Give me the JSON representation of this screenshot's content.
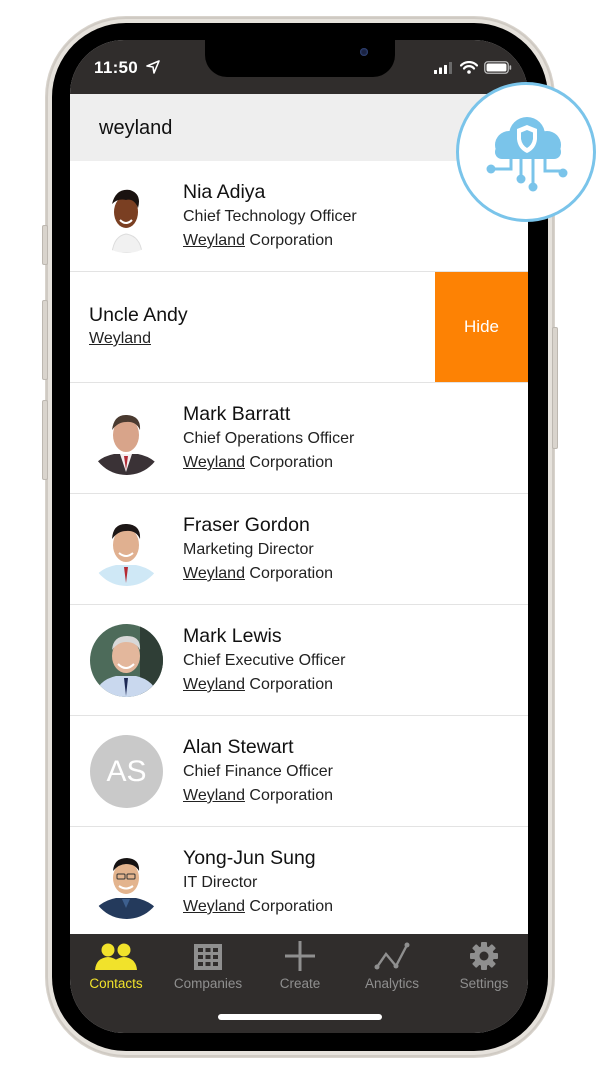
{
  "status_bar": {
    "time": "11:50",
    "icons": [
      "location-arrow-icon",
      "cellular-signal-icon",
      "wifi-icon",
      "battery-icon"
    ]
  },
  "search": {
    "value": "weyland"
  },
  "badge": {
    "icon": "cloud-shield-network-icon",
    "color": "#7ac4ea"
  },
  "contacts": [
    {
      "name": "Nia Adiya",
      "title": "Chief Technology Officer",
      "company_match": "Weyland",
      "company_rest": " Corporation",
      "avatar": "photo"
    },
    {
      "name": "Uncle Andy",
      "company_match": "Weyland",
      "swiped": true,
      "action_label": "Hide",
      "action_color": "#fd8204"
    },
    {
      "name": "Mark Barratt",
      "title": "Chief Operations Officer",
      "company_match": "Weyland",
      "company_rest": " Corporation",
      "avatar": "photo"
    },
    {
      "name": "Fraser Gordon",
      "title": "Marketing Director",
      "company_match": "Weyland",
      "company_rest": " Corporation",
      "avatar": "photo"
    },
    {
      "name": "Mark Lewis",
      "title": "Chief Executive Officer",
      "company_match": "Weyland",
      "company_rest": " Corporation",
      "avatar": "photo"
    },
    {
      "name": "Alan Stewart",
      "title": "Chief Finance Officer",
      "company_match": "Weyland",
      "company_rest": " Corporation",
      "avatar": "initials",
      "initials": "AS"
    },
    {
      "name": "Yong-Jun Sung",
      "title": "IT Director",
      "company_match": "Weyland",
      "company_rest": " Corporation",
      "avatar": "photo"
    }
  ],
  "tabbar": {
    "active_color": "#f1e22b",
    "inactive_color": "#8f8f8f",
    "tabs": [
      {
        "label": "Contacts",
        "icon": "contacts-icon",
        "active": true
      },
      {
        "label": "Companies",
        "icon": "building-icon",
        "active": false
      },
      {
        "label": "Create",
        "icon": "plus-icon",
        "active": false
      },
      {
        "label": "Analytics",
        "icon": "line-chart-icon",
        "active": false
      },
      {
        "label": "Settings",
        "icon": "gear-icon",
        "active": false
      }
    ]
  }
}
